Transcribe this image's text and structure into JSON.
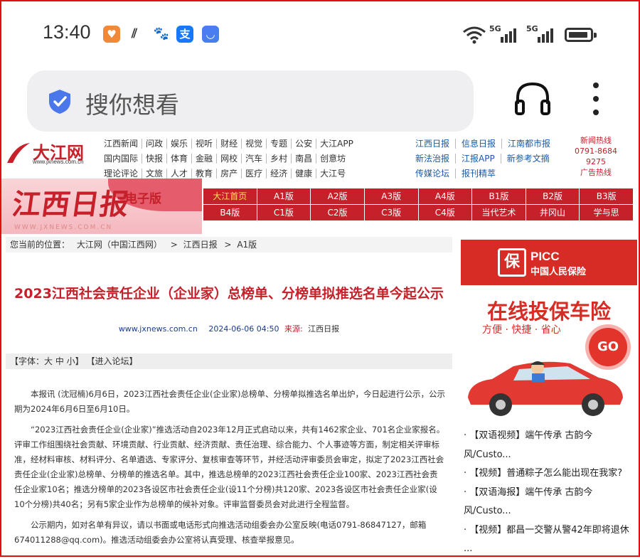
{
  "status_bar": {
    "time": "13:40",
    "net_label_1": "5G",
    "net_label_2": "5G",
    "alipay_glyph": "支"
  },
  "search": {
    "placeholder": "搜你想看"
  },
  "site": {
    "logo_text": "大江网",
    "logo_url": "www.jxnews.com.cn",
    "nav_rows": [
      [
        "江西新闻",
        "问政",
        "娱乐",
        "视听",
        "财经",
        "视觉",
        "专题",
        "公安",
        "大江APP"
      ],
      [
        "国内国际",
        "快报",
        "体育",
        "金融",
        "网校",
        "汽车",
        "乡村",
        "南昌",
        "创意坊"
      ],
      [
        "理论评论",
        "文旅",
        "人才",
        "教育",
        "房产",
        "医疗",
        "经济",
        "健康",
        "大江号"
      ]
    ],
    "nav_rows_right": [
      [
        "江西日报",
        "信息日报",
        "江南都市报"
      ],
      [
        "新法治报",
        "江报APP",
        "新参考文摘"
      ],
      [
        "传媒论坛",
        "报刊精萃",
        ""
      ]
    ],
    "hotline_label": "新闻热线",
    "hotline_number": "0791-86849275",
    "ad_hotline": "广告热线",
    "banner_title": "江西日报",
    "banner_edition": "电子版",
    "banner_url": "WWW.JXNEWS.COM.CN",
    "pages": [
      "大江首页",
      "A1版",
      "A2版",
      "A3版",
      "A4版",
      "B1版",
      "B2版",
      "B3版",
      "B4版",
      "C1版",
      "C2版",
      "C3版",
      "C4版",
      "当代艺术",
      "井冈山",
      "学与思"
    ]
  },
  "breadcrumb": {
    "prefix": "您当前的位置：",
    "items": [
      "大江网（中国江西网）",
      "江西日报",
      "A1版"
    ],
    "sep": ">"
  },
  "article": {
    "title": "2023江西社会责任企业（企业家）总榜单、分榜单拟推选名单今起公示",
    "site": "www.jxnews.com.cn",
    "date": "2024-06-06 04:50",
    "source_label": "来源:",
    "source": "江西日报",
    "font_bar": "【字体：大 中 小】 【进入论坛】",
    "paragraphs": [
      "本报讯 (沈冠楠)6月6日，2023江西社会责任企业(企业家)总榜单、分榜单拟推选名单出炉，今日起进行公示，公示期为2024年6月6日至6月10日。",
      "“2023江西社会责任企业(企业家)”推选活动自2023年12月正式启动以来，共有1462家企业、701名企业家报名。评审工作组围绕社会贡献、环境贡献、行业贡献、经济贡献、责任治理、综合能力、个人事迹等方面，制定相关评审标准，经材料审核、材料评分、名单遴选、专家评分、复核审查等环节，并经活动评审委员会审定，拟定了2023江西社会责任企业(企业家)总榜单、分榜单的推选名单。其中，推选总榜单的2023江西社会责任企业100家、2023江西社会责任企业家10名；推选分榜单的2023各设区市社会责任企业(设11个分榜)共120家、2023各设区市社会责任企业家(设10个分榜)共40名；另有5家企业作为总榜单的候补对象。评审监督委员会对此进行全程监督。",
      "公示期内，如对名单有异议，请以书面或电话形式向推选活动组委会办公室反映(电话0791-86847127，邮箱674011288@qq.com)。推选活动组委会办公室将认真受理、核查举报意见。"
    ]
  },
  "ad": {
    "seal_glyph": "保",
    "brand": "PICC",
    "brand_cn": "中国人民保险",
    "headline": "在线投保车险",
    "sub": "方便 · 快捷 · 省心",
    "go": "GO"
  },
  "side_news": [
    "· 【双语视频】端午传承 古韵今",
    "风/Custo...",
    "· 【视频】普通粽子怎么能出现在我家?",
    "· 【双语海报】端午传承 古韵今",
    "风/Custo...",
    "· 【视频】都昌一交警从警42年即将退休",
    "..."
  ]
}
